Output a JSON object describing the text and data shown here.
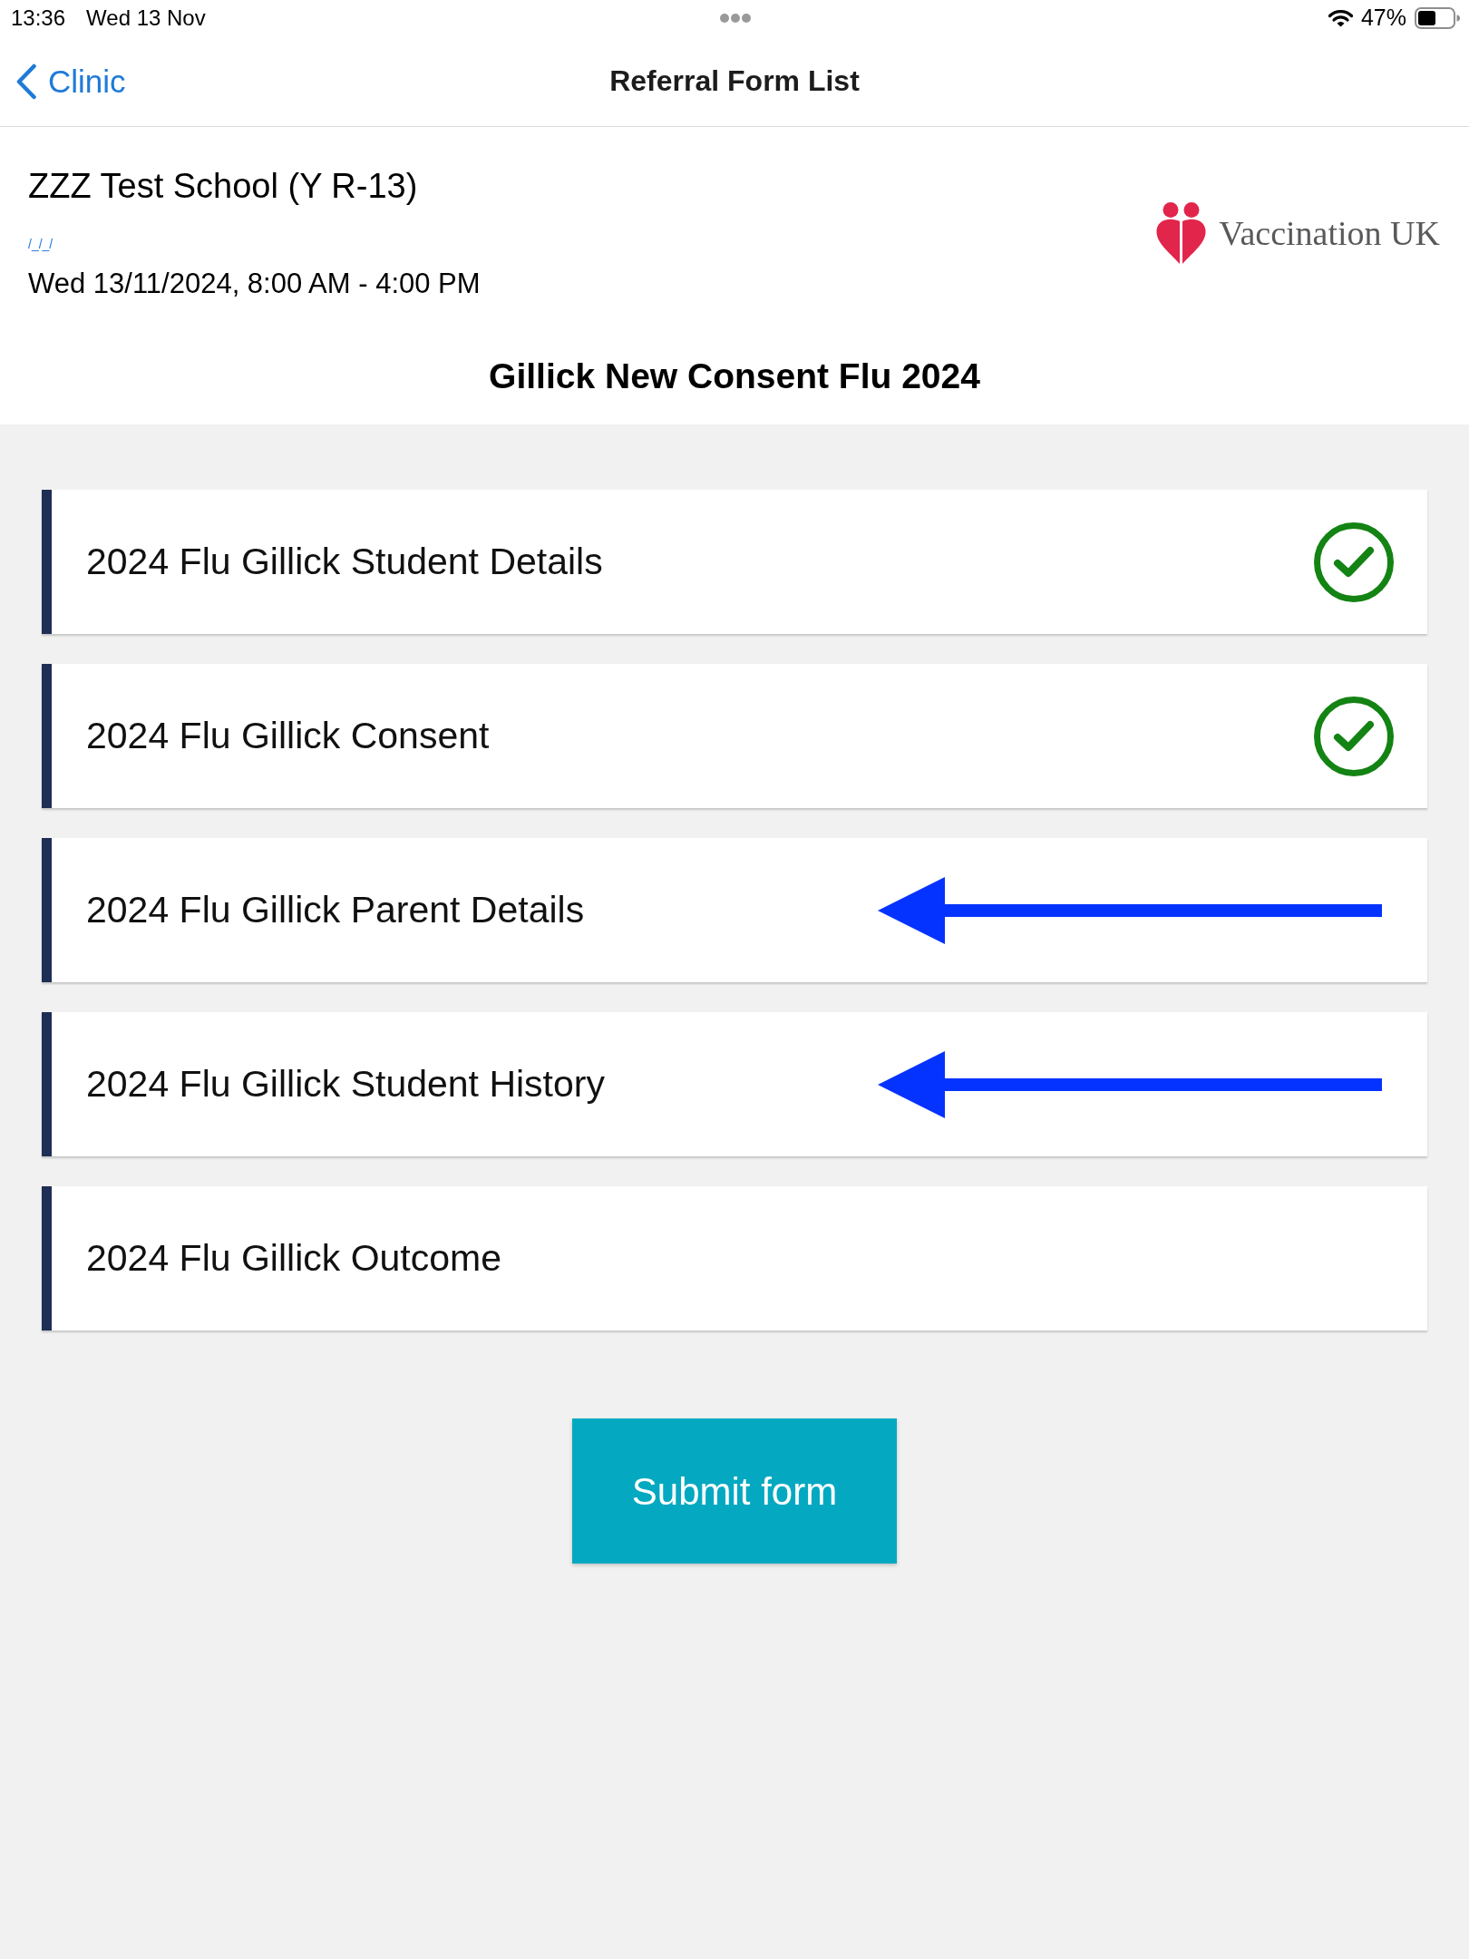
{
  "status_bar": {
    "time": "13:36",
    "date": "Wed 13 Nov",
    "battery_percent": "47%"
  },
  "nav_bar": {
    "back_label": "Clinic",
    "title": "Referral Form List"
  },
  "header": {
    "school": "ZZZ Test School (Y R-13)",
    "link": "/_/_/",
    "session_time": "Wed 13/11/2024, 8:00 AM - 4:00 PM",
    "logo_text": "Vaccination UK",
    "form_title": "Gillick New Consent Flu 2024"
  },
  "sections": [
    {
      "label": "2024 Flu Gillick Student Details",
      "completed": true,
      "arrow_annotation": false
    },
    {
      "label": "2024 Flu Gillick Consent",
      "completed": true,
      "arrow_annotation": false
    },
    {
      "label": "2024 Flu Gillick Parent Details",
      "completed": false,
      "arrow_annotation": true
    },
    {
      "label": "2024 Flu Gillick Student History",
      "completed": false,
      "arrow_annotation": true
    },
    {
      "label": "2024 Flu Gillick Outcome",
      "completed": false,
      "arrow_annotation": false
    }
  ],
  "submit_button": "Submit form"
}
